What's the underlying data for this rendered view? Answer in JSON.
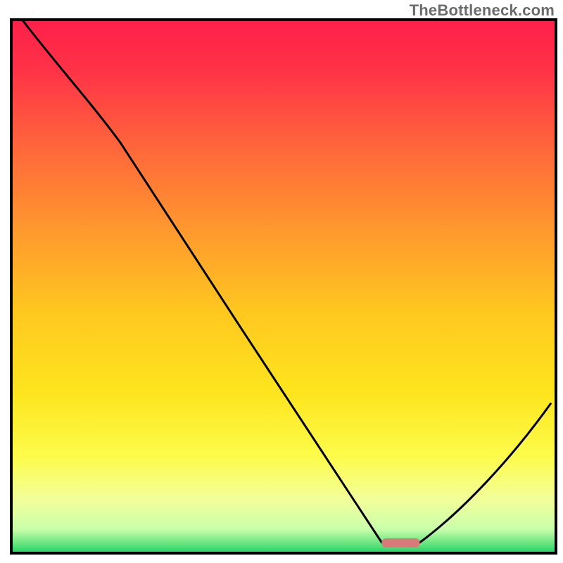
{
  "watermark": "TheBottleneck.com",
  "chart_data": {
    "type": "line",
    "title": "",
    "xlabel": "",
    "ylabel": "",
    "xlim": [
      0,
      100
    ],
    "ylim": [
      0,
      100
    ],
    "x": [
      2,
      20,
      68,
      75,
      99
    ],
    "series": [
      {
        "name": "curve",
        "values": [
          100,
          77,
          2,
          2,
          28
        ]
      }
    ],
    "marker": {
      "x_range": [
        68,
        75
      ],
      "y": 2,
      "color": "#d87a7a"
    },
    "annotations": [],
    "grid": false,
    "legend": false,
    "background_gradient": {
      "stops": [
        {
          "offset": 0.0,
          "color": "#ff1f4a"
        },
        {
          "offset": 0.1,
          "color": "#ff3447"
        },
        {
          "offset": 0.25,
          "color": "#ff6a3a"
        },
        {
          "offset": 0.4,
          "color": "#ff9a2e"
        },
        {
          "offset": 0.55,
          "color": "#ffc81f"
        },
        {
          "offset": 0.7,
          "color": "#fde51e"
        },
        {
          "offset": 0.82,
          "color": "#fdfc4c"
        },
        {
          "offset": 0.9,
          "color": "#f2ff9a"
        },
        {
          "offset": 0.955,
          "color": "#c9ffab"
        },
        {
          "offset": 0.985,
          "color": "#5be27a"
        },
        {
          "offset": 1.0,
          "color": "#1fd168"
        }
      ]
    },
    "frame_color": "#000000",
    "curve_stroke": "#000000",
    "curve_width": 3
  }
}
